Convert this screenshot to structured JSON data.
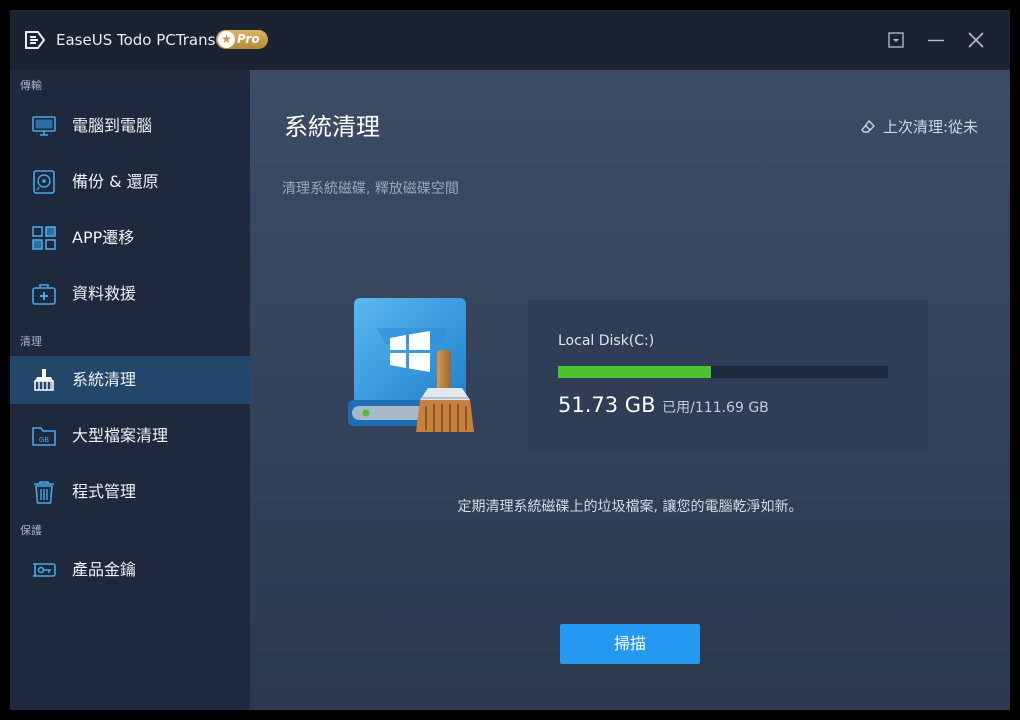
{
  "app": {
    "title": "EaseUS Todo PCTrans",
    "badge": "Pro"
  },
  "sidebar": {
    "sections": [
      {
        "label": "傳輸"
      },
      {
        "label": "清理"
      },
      {
        "label": "保護"
      }
    ],
    "items": [
      {
        "label": "電腦到電腦",
        "icon": "monitor-icon"
      },
      {
        "label": "備份 & 還原",
        "icon": "disc-icon"
      },
      {
        "label": "APP遷移",
        "icon": "apps-grid-icon"
      },
      {
        "label": "資料救援",
        "icon": "first-aid-kit-icon"
      },
      {
        "label": "系統清理",
        "icon": "broom-icon",
        "active": true
      },
      {
        "label": "大型檔案清理",
        "icon": "gb-folder-icon"
      },
      {
        "label": "程式管理",
        "icon": "trash-icon"
      },
      {
        "label": "產品金鑰",
        "icon": "key-icon"
      }
    ]
  },
  "main": {
    "title": "系統清理",
    "last_clean": "上次清理:從未",
    "subtitle": "清理系統磁碟, 釋放磁碟空間",
    "disk": {
      "name": "Local Disk(C:)",
      "used": "51.73 GB",
      "used_label": "已用",
      "total": "/111.69 GB",
      "used_fraction": 0.4632
    },
    "description": "定期清理系統磁碟上的垃圾檔案, 讓您的電腦乾淨如新。",
    "scan_button": "掃描"
  },
  "colors": {
    "accent": "#2399f2",
    "progress": "#4cc22e",
    "active_nav": "#23466b"
  }
}
